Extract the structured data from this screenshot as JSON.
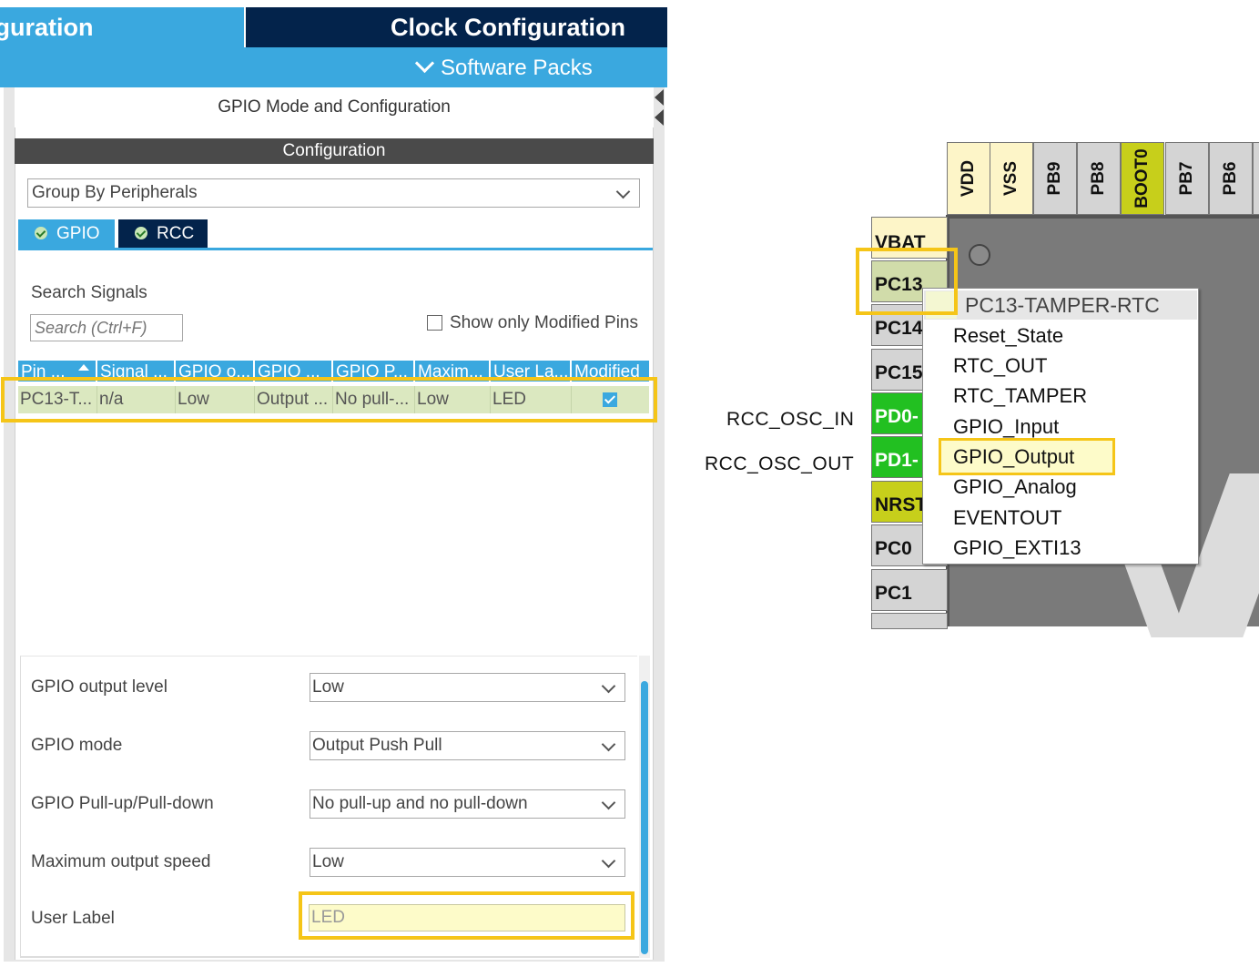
{
  "header": {
    "tab_pinout": "figuration",
    "tab_clock": "Clock Configuration",
    "software_packs": "Software Packs"
  },
  "panel": {
    "title": "GPIO Mode and Configuration",
    "config_bar": "Configuration",
    "group_select": "Group By Peripherals",
    "tabs": [
      {
        "label": "GPIO"
      },
      {
        "label": "RCC"
      }
    ],
    "search_label": "Search Signals",
    "search_placeholder": "Search (Ctrl+F)",
    "show_modified_label": "Show only Modified Pins",
    "table": {
      "columns": [
        "Pin ...",
        "Signal ...",
        "GPIO o...",
        "GPIO ...",
        "GPIO P...",
        "Maxim...",
        "User La...",
        "Modified"
      ],
      "rows": [
        {
          "pin": "PC13-T...",
          "signal": "n/a",
          "gpio_output_level": "Low",
          "gpio_mode": "Output ...",
          "gpio_pull": "No pull-...",
          "max_speed": "Low",
          "user_label": "LED",
          "modified": true
        }
      ]
    },
    "settings": {
      "output_level_label": "GPIO output level",
      "output_level_value": "Low",
      "mode_label": "GPIO mode",
      "mode_value": "Output Push Pull",
      "pull_label": "GPIO Pull-up/Pull-down",
      "pull_value": "No pull-up and no pull-down",
      "speed_label": "Maximum output speed",
      "speed_value": "Low",
      "user_label_label": "User Label",
      "user_label_value": "LED"
    }
  },
  "chip": {
    "top_pins": [
      "VDD",
      "VSS",
      "PB9",
      "PB8",
      "BOOT0",
      "PB7",
      "PB6"
    ],
    "left_pins": [
      "VBAT",
      "PC13",
      "PC14",
      "PC15",
      "PD0-",
      "PD1-",
      "NRST",
      "PC0",
      "PC1"
    ],
    "external_labels": {
      "osc_in": "RCC_OSC_IN",
      "osc_out": "RCC_OSC_OUT"
    },
    "context_menu": {
      "title": "PC13-TAMPER-RTC",
      "items": [
        "Reset_State",
        "RTC_OUT",
        "RTC_TAMPER",
        "GPIO_Input",
        "GPIO_Output",
        "GPIO_Analog",
        "EVENTOUT",
        "GPIO_EXTI13"
      ],
      "highlighted": "GPIO_Output"
    }
  },
  "colors": {
    "accent_blue": "#3aa8df",
    "dark_navy": "#03234b",
    "highlight_yellow": "#f5c518",
    "pin_green": "#22c021",
    "pin_olive": "#c7cf1b"
  }
}
